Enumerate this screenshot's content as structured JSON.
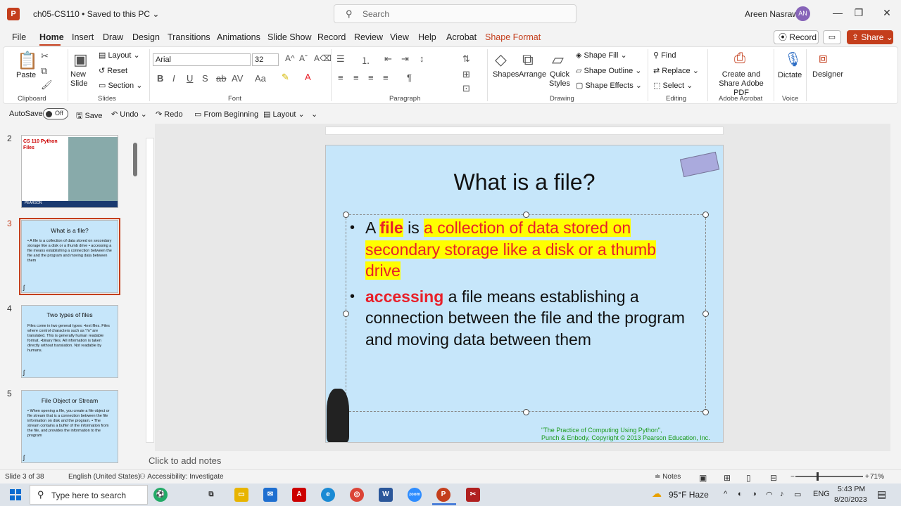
{
  "titlebar": {
    "doc_title": "ch05-CS110 • Saved to this PC ⌄",
    "search_placeholder": "Search",
    "user_name": "Areen Nasrawi",
    "avatar_initials": "AN"
  },
  "menu": {
    "file": "File",
    "home": "Home",
    "insert": "Insert",
    "draw": "Draw",
    "design": "Design",
    "transitions": "Transitions",
    "animations": "Animations",
    "slideshow": "Slide Show",
    "record": "Record",
    "review": "Review",
    "view": "View",
    "help": "Help",
    "acrobat": "Acrobat",
    "shapeformat": "Shape Format",
    "record_btn": "Record",
    "share_btn": "Share"
  },
  "ribbon": {
    "paste": "Paste",
    "clipboard": "Clipboard",
    "new_slide": "New Slide",
    "layout": "Layout",
    "reset": "Reset",
    "section": "Section",
    "slides": "Slides",
    "font_name": "Arial",
    "font_size": "32",
    "font": "Font",
    "paragraph": "Paragraph",
    "shapes": "Shapes",
    "arrange": "Arrange",
    "quick_styles": "Quick Styles",
    "shape_fill": "Shape Fill",
    "shape_outline": "Shape Outline",
    "shape_effects": "Shape Effects",
    "drawing": "Drawing",
    "find": "Find",
    "replace": "Replace",
    "select": "Select",
    "editing": "Editing",
    "create_share": "Create and Share Adobe PDF",
    "adobe_acrobat": "Adobe Acrobat",
    "dictate": "Dictate",
    "voice": "Voice",
    "designer": "Designer"
  },
  "qat": {
    "autosave": "AutoSave",
    "autosave_state": "Off",
    "save": "Save",
    "undo": "Undo",
    "redo": "Redo",
    "from_beginning": "From Beginning",
    "layout": "Layout"
  },
  "thumbnails": [
    {
      "num": "2",
      "title": "CS 110 Python Files",
      "footer": "PEARSON"
    },
    {
      "num": "3",
      "title": "What is a file?",
      "body": "• A file is a collection of data stored on secondary storage like a disk or a thumb drive • accessing a file means establishing a connection between the file and the program and moving data between them"
    },
    {
      "num": "4",
      "title": "Two types of files",
      "body": "Files come in two general types: •text files. Files where control characters such as \"/n\" are translated. This is generally human readable format. •binary files. All information is taken directly without translation. Not readable by humans."
    },
    {
      "num": "5",
      "title": "File Object or Stream",
      "body": "• When opening a file, you create a file object or file stream that is a connection between the file information on disk and the program. • The stream contains a buffer of the information from the file, and provides the information to the program"
    }
  ],
  "slide": {
    "title": "What is a file?",
    "b1_a": "A ",
    "b1_file": "file",
    "b1_is": " is ",
    "b1_rest": "a collection of data stored on secondary storage like a disk or a thumb drive",
    "b2_accessing": "accessing",
    "b2_rest": " a file means establishing a connection between the file and the program and moving data between them",
    "credit_1": "\"The Practice of Computing Using Python\",",
    "credit_2": "Punch & Enbody, Copyright © 2013 Pearson Education, Inc."
  },
  "notes_placeholder": "Click to add notes",
  "status": {
    "slide_of": "Slide 3 of 38",
    "language": "English (United States)",
    "accessibility": "Accessibility: Investigate",
    "notes": "Notes",
    "zoom": "71%"
  },
  "taskbar": {
    "search": "Type here to search",
    "weather": "95°F Haze",
    "lang": "ENG",
    "time": "5:43 PM",
    "date": "8/20/2023"
  }
}
